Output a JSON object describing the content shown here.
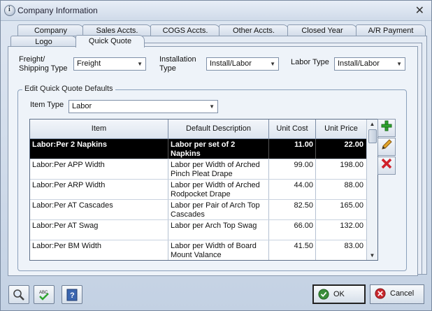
{
  "window": {
    "title": "Company Information",
    "close_glyph": "✕"
  },
  "tabs_row1": [
    {
      "label": "Company"
    },
    {
      "label": "Sales Accts."
    },
    {
      "label": "COGS Accts."
    },
    {
      "label": "Other Accts."
    },
    {
      "label": "Closed Year"
    },
    {
      "label": "A/R Payment"
    }
  ],
  "tabs_row2": [
    {
      "label": "Logo"
    },
    {
      "label": "Quick Quote"
    }
  ],
  "fields": {
    "freight_label": "Freight/\nShipping Type",
    "freight_value": "Freight",
    "installation_label": "Installation\nType",
    "installation_value": "Install/Labor",
    "labor_label": "Labor Type",
    "labor_value": "Install/Labor"
  },
  "group": {
    "title": "Edit Quick Quote Defaults",
    "item_type_label": "Item Type",
    "item_type_value": "Labor"
  },
  "grid": {
    "columns": [
      "Item",
      "Default Description",
      "Unit Cost",
      "Unit Price"
    ],
    "rows": [
      {
        "item": "Labor:Per 2 Napkins",
        "desc": "Labor per set of 2 Napkins",
        "cost": "11.00",
        "price": "22.00",
        "selected": true
      },
      {
        "item": "Labor:Per APP Width",
        "desc": "Labor per Width of Arched Pinch Pleat Drape",
        "cost": "99.00",
        "price": "198.00"
      },
      {
        "item": "Labor:Per ARP Width",
        "desc": "Labor per Width of Arched Rodpocket Drape",
        "cost": "44.00",
        "price": "88.00"
      },
      {
        "item": "Labor:Per AT Cascades",
        "desc": "Labor per Pair of Arch Top Cascades",
        "cost": "82.50",
        "price": "165.00"
      },
      {
        "item": "Labor:Per AT Swag",
        "desc": "Labor per Arch Top Swag",
        "cost": "66.00",
        "price": "132.00"
      },
      {
        "item": "Labor:Per BM Width",
        "desc": "Labor per Width of Board Mount Valance",
        "cost": "41.50",
        "price": "83.00"
      }
    ]
  },
  "side_buttons": [
    "add-icon",
    "edit-pencil-icon",
    "delete-x-icon"
  ],
  "bottom": {
    "ok_label": "OK",
    "cancel_label": "Cancel",
    "tools": [
      "zoom-icon",
      "spellcheck-icon",
      "help-icon"
    ]
  },
  "colors": {
    "add": "#2fa52f",
    "delete": "#d0202a",
    "ok": "#3a8d3a",
    "cancel": "#c8282e",
    "selected_row": "#000000"
  }
}
